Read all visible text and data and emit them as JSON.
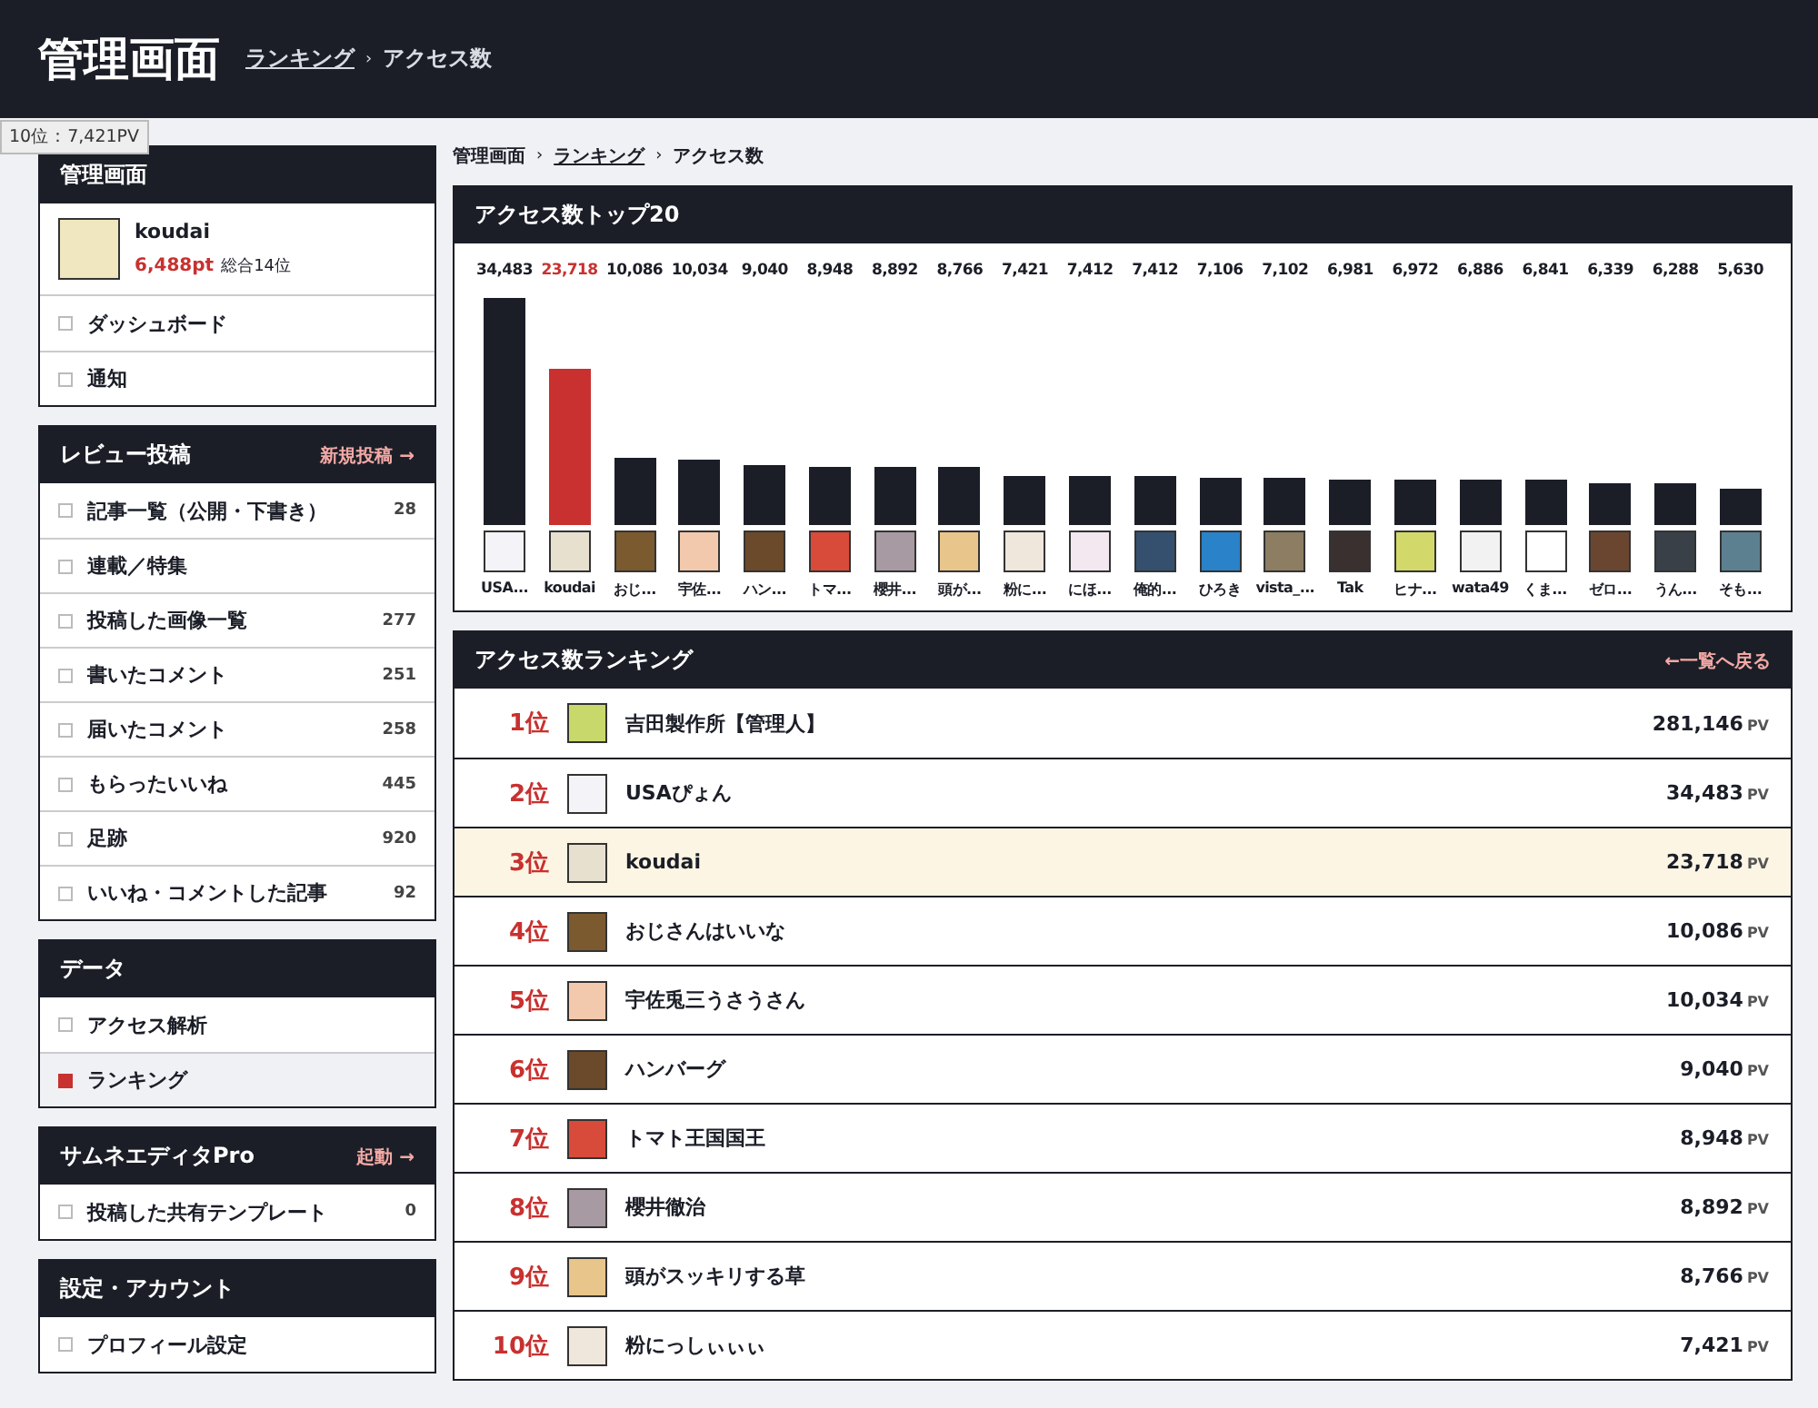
{
  "header": {
    "title": "管理画面",
    "breadcrumb": [
      {
        "label": "ランキング",
        "link": true
      },
      {
        "separator": "›",
        "label": "アクセス数",
        "link": false
      }
    ]
  },
  "tooltip": "10位：7,421PV",
  "sidebar": [
    {
      "title": "管理画面",
      "user": {
        "name": "koudai",
        "points": "6,488pt",
        "rank": "総合14位"
      },
      "items": [
        {
          "label": "ダッシュボード",
          "selected": false
        },
        {
          "label": "通知",
          "selected": false
        }
      ]
    },
    {
      "title": "レビュー投稿",
      "action": "新規投稿 →",
      "items": [
        {
          "label": "記事一覧（公開・下書き）",
          "count": "28",
          "selected": false
        },
        {
          "label": "連載／特集",
          "selected": false
        },
        {
          "label": "投稿した画像一覧",
          "count": "277",
          "selected": false
        },
        {
          "label": "書いたコメント",
          "count": "251",
          "selected": false
        },
        {
          "label": "届いたコメント",
          "count": "258",
          "selected": false
        },
        {
          "label": "もらったいいね",
          "count": "445",
          "selected": false
        },
        {
          "label": "足跡",
          "count": "920",
          "selected": false
        },
        {
          "label": "いいね・コメントした記事",
          "count": "92",
          "selected": false
        }
      ]
    },
    {
      "title": "データ",
      "items": [
        {
          "label": "アクセス解析",
          "selected": false
        },
        {
          "label": "ランキング",
          "selected": true
        }
      ]
    },
    {
      "title": "サムネエディタPro",
      "action": "起動 →",
      "items": [
        {
          "label": "投稿した共有テンプレート",
          "count": "0",
          "selected": false
        }
      ]
    },
    {
      "title": "設定・アカウント",
      "items": [
        {
          "label": "プロフィール設定",
          "selected": false
        }
      ]
    }
  ],
  "breadcrumb": [
    {
      "label": "管理画面",
      "link": false
    },
    {
      "separator": "›",
      "label": "ランキング",
      "link": true
    },
    {
      "separator": "›",
      "label": "アクセス数",
      "link": false
    }
  ],
  "top_chart": {
    "title": "アクセス数トップ20",
    "highlighted": [
      false,
      true,
      false,
      false,
      false,
      false,
      false,
      false,
      false,
      false,
      false,
      false,
      false,
      false,
      false,
      false,
      false,
      false,
      false,
      false
    ],
    "chart_data": {
      "type": "bar",
      "data_labels": true,
      "categories": [
        "USA...",
        "koudai",
        "おじ...",
        "宇佐...",
        "ハン...",
        "トマ...",
        "櫻井...",
        "頭が...",
        "粉に...",
        "にほ...",
        "俺的...",
        "ひろき",
        "vista_...",
        "Tak",
        "ヒナ...",
        "wata49",
        "くま...",
        "ゼロ...",
        "うん...",
        "そも..."
      ],
      "values": [
        34483,
        23718,
        10086,
        10034,
        9040,
        8948,
        8892,
        8766,
        7421,
        7412,
        7412,
        7106,
        7102,
        6981,
        6972,
        6886,
        6841,
        6339,
        6288,
        5630
      ],
      "value_labels": [
        "34,483",
        "23,718",
        "10,086",
        "10,034",
        "9,040",
        "8,948",
        "8,892",
        "8,766",
        "7,421",
        "7,412",
        "7,412",
        "7,106",
        "7,102",
        "6,981",
        "6,972",
        "6,886",
        "6,841",
        "6,339",
        "6,288",
        "5,630"
      ]
    }
  },
  "ranking": {
    "title": "アクセス数ランキング",
    "back_link": "←一覧へ戻る",
    "rows": [
      {
        "rank": "1位",
        "name": "吉田製作所【管理人】",
        "pv": "281,146",
        "unit": "PV",
        "selected": false
      },
      {
        "rank": "2位",
        "name": "USAぴょん",
        "pv": "34,483",
        "unit": "PV",
        "selected": false
      },
      {
        "rank": "3位",
        "name": "koudai",
        "pv": "23,718",
        "unit": "PV",
        "selected": true
      },
      {
        "rank": "4位",
        "name": "おじさんはいいな",
        "pv": "10,086",
        "unit": "PV",
        "selected": false
      },
      {
        "rank": "5位",
        "name": "宇佐兎三うさうさん",
        "pv": "10,034",
        "unit": "PV",
        "selected": false
      },
      {
        "rank": "6位",
        "name": "ハンバーグ",
        "pv": "9,040",
        "unit": "PV",
        "selected": false
      },
      {
        "rank": "7位",
        "name": "トマト王国国王",
        "pv": "8,948",
        "unit": "PV",
        "selected": false
      },
      {
        "rank": "8位",
        "name": "櫻井徹治",
        "pv": "8,892",
        "unit": "PV",
        "selected": false
      },
      {
        "rank": "9位",
        "name": "頭がスッキリする草",
        "pv": "8,766",
        "unit": "PV",
        "selected": false
      },
      {
        "rank": "10位",
        "name": "粉にっしぃぃぃ",
        "pv": "7,421",
        "unit": "PV",
        "selected": false
      }
    ]
  }
}
